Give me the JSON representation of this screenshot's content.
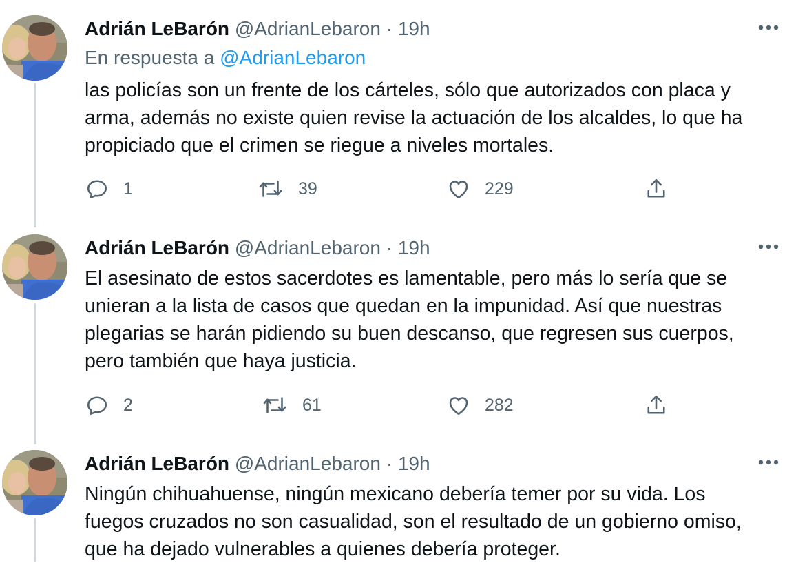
{
  "tweets": [
    {
      "name": "Adrián LeBarón",
      "handle": "@AdrianLebaron",
      "separator": "·",
      "time": "19h",
      "reply_prefix": "En respuesta a",
      "reply_mention": "@AdrianLebaron",
      "lines": [
        "las policías son un frente de los cárteles, sólo que autorizados con placa y",
        "arma, además no existe quien revise la actuación de los alcaldes, lo que ha",
        "propiciado que el crimen se riegue a niveles mortales."
      ],
      "replies": "1",
      "retweets": "39",
      "likes": "229"
    },
    {
      "name": "Adrián LeBarón",
      "handle": "@AdrianLebaron",
      "separator": "·",
      "time": "19h",
      "lines": [
        "El asesinato de estos sacerdotes es lamentable, pero más lo sería que se",
        "unieran a la lista de casos que quedan en la impunidad. Así que nuestras",
        "plegarias se harán pidiendo su buen descanso, que regresen sus cuerpos,",
        "pero también que haya justicia."
      ],
      "replies": "2",
      "retweets": "61",
      "likes": "282"
    },
    {
      "name": "Adrián LeBarón",
      "handle": "@AdrianLebaron",
      "separator": "·",
      "time": "19h",
      "lines": [
        "Ningún chihuahuense, ningún mexicano debería temer por su vida. Los",
        "fuegos cruzados no son casualidad, son el resultado de un gobierno omiso,",
        "que ha dejado vulnerables a quienes debería proteger."
      ]
    }
  ],
  "icons": {
    "avatar": "profile-photo",
    "more": "more-horizontal-icon",
    "reply": "reply-bubble-icon",
    "retweet": "retweet-icon",
    "like": "heart-icon",
    "share": "share-icon"
  },
  "colors": {
    "text": "#0f1419",
    "muted": "#536471",
    "link": "#1d9bf0",
    "thread_line": "#cfd9de"
  }
}
